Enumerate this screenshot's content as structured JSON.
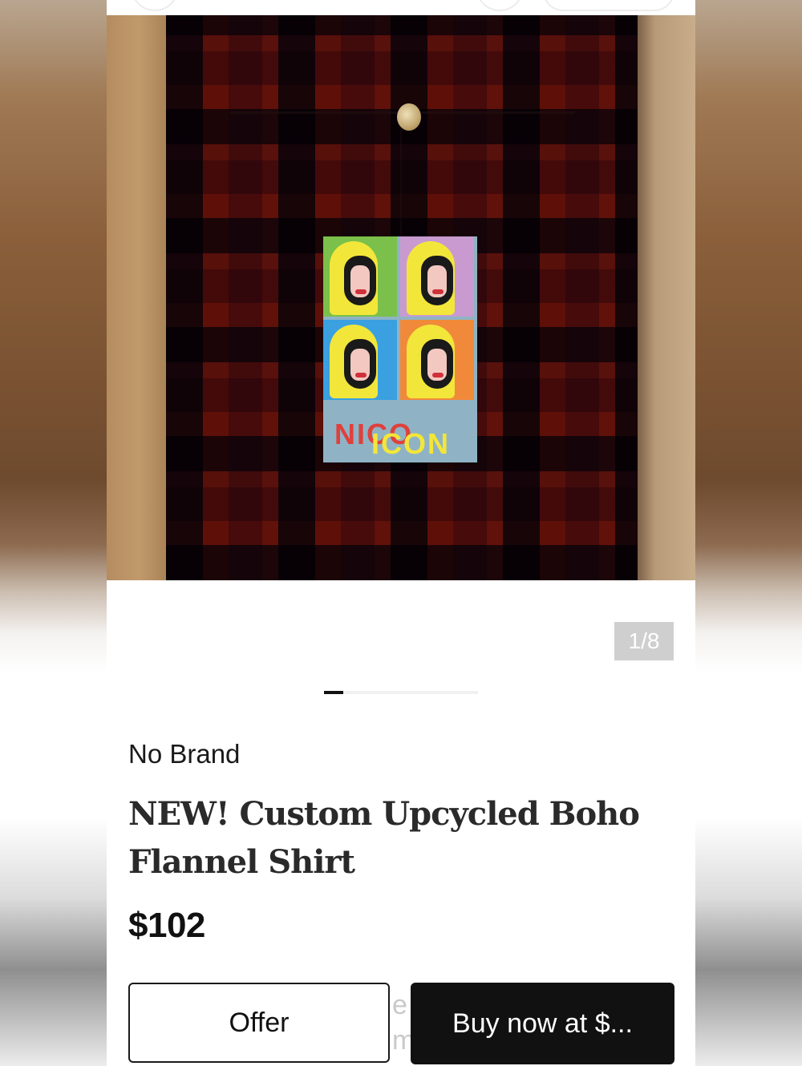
{
  "listing": {
    "image_counter": "1/8",
    "brand": "No Brand",
    "title": "NEW! Custom Upcycled Boho Flannel Shirt",
    "price": "$102",
    "patch_text_1": "NICO",
    "patch_text_2": "ICON",
    "gallery_position": 0.125
  },
  "actions": {
    "offer_label": "Offer",
    "buy_label": "Buy now at $..."
  },
  "obscured": {
    "text_line_1": "e",
    "text_line_2": "m"
  }
}
